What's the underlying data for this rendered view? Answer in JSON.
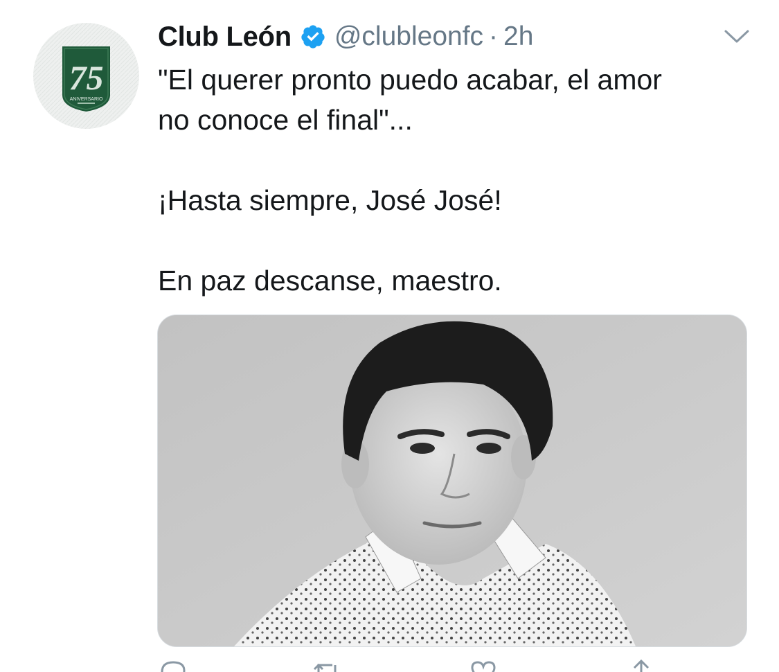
{
  "tweet": {
    "display_name": "Club León",
    "handle": "@clubleonfc",
    "separator": "·",
    "timestamp": "2h",
    "text_line1": "\"El querer pronto puedo acabar, el amor",
    "text_line2": "no conoce el final\"...",
    "text_line3": "¡Hasta siempre, José José!",
    "text_line4": "En paz descanse, maestro.",
    "avatar_text": "75",
    "avatar_subtext": "ANIVERSARIO"
  },
  "actions": {
    "reply_count": "",
    "retweet_count": "",
    "like_count": ""
  },
  "colors": {
    "text_primary": "#14171a",
    "text_secondary": "#657786",
    "verified_blue": "#1da1f2",
    "club_green": "#1f5a3a"
  },
  "icons": {
    "verified": "verified-badge-icon",
    "caret": "chevron-down-icon",
    "reply": "reply-icon",
    "retweet": "retweet-icon",
    "like": "heart-icon",
    "share": "share-icon"
  }
}
